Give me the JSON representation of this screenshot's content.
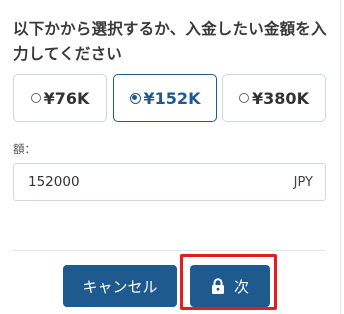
{
  "instruction": "以下かから選択するか、入金したい金額を入力してください",
  "amount_options": [
    {
      "label": "¥76K",
      "selected": false
    },
    {
      "label": "¥152K",
      "selected": true
    },
    {
      "label": "¥380K",
      "selected": false
    }
  ],
  "amount_field": {
    "label": "額：",
    "value": "152000",
    "currency": "JPY"
  },
  "buttons": {
    "cancel_label": "キャンセル",
    "next_label": "次",
    "next_icon": "lock-icon"
  },
  "colors": {
    "accent": "#1e5a8e",
    "highlight": "#e02020",
    "border": "#cfd6de"
  }
}
